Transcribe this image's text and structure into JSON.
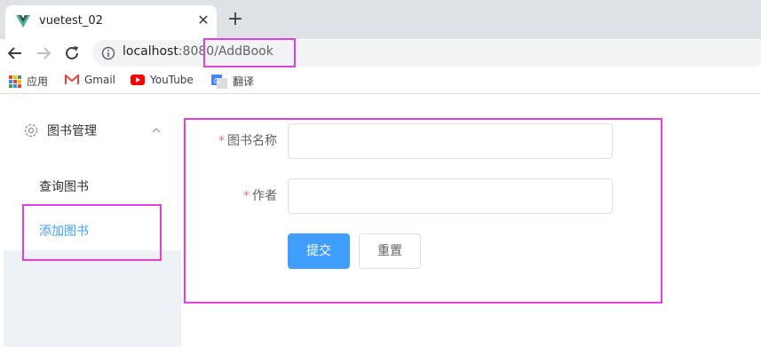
{
  "browser": {
    "tab": {
      "title": "vuetest_02",
      "close_glyph": "✕"
    },
    "new_tab_glyph": "+",
    "address": {
      "host": "localhost",
      "rest": ":8080/AddBook"
    },
    "bookmarks": [
      {
        "label": "应用",
        "icon": "apps-grid-icon"
      },
      {
        "label": "Gmail",
        "icon": "gmail-icon"
      },
      {
        "label": "YouTube",
        "icon": "youtube-icon"
      },
      {
        "label": "翻译",
        "icon": "translate-icon"
      }
    ]
  },
  "sidebar": {
    "submenu_title": "图书管理",
    "items": [
      {
        "label": "查询图书",
        "active": false
      },
      {
        "label": "添加图书",
        "active": true
      }
    ]
  },
  "form": {
    "fields": [
      {
        "label": "图书名称",
        "required_mark": "*",
        "value": ""
      },
      {
        "label": "作者",
        "required_mark": "*",
        "value": ""
      }
    ],
    "submit_label": "提交",
    "reset_label": "重置"
  },
  "colors": {
    "primary": "#409eff",
    "required": "#f56c6c",
    "annotation": "#e040e0"
  }
}
